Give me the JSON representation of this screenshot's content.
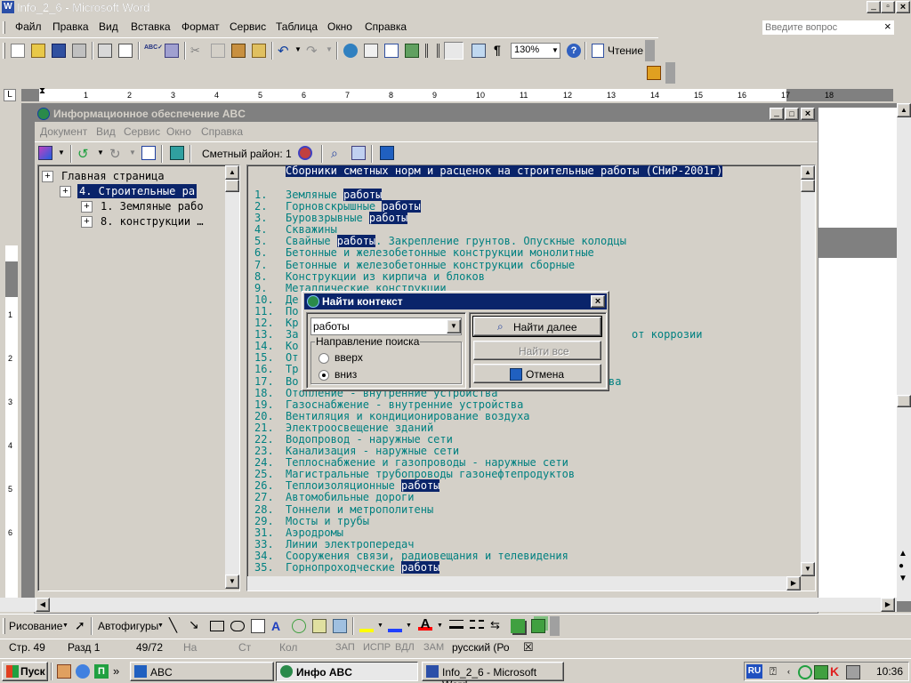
{
  "word": {
    "title": "Info_2_6 - Microsoft Word",
    "menu": [
      "Файл",
      "Правка",
      "Вид",
      "Вставка",
      "Формат",
      "Сервис",
      "Таблица",
      "Окно",
      "Справка"
    ],
    "help_placeholder": "Введите вопрос",
    "zoom": "130%",
    "reading_label": "Чтение",
    "ruler_numbers": [
      "1",
      "2",
      "3",
      "4",
      "5",
      "6",
      "7",
      "8",
      "9",
      "10",
      "11",
      "12",
      "13",
      "14",
      "15",
      "16",
      "17",
      "18"
    ],
    "vruler_numbers": [
      "1",
      "1",
      "2",
      "3",
      "4",
      "5",
      "6"
    ]
  },
  "abc": {
    "title": "Информационное обеспечение ABC",
    "menu": [
      "Документ",
      "Вид",
      "Сервис",
      "Окно",
      "Справка"
    ],
    "district_label": "Сметный район: 1",
    "tree": [
      {
        "label": "Главная страница",
        "level": 0,
        "selected": false
      },
      {
        "label": "4. Строительные ра",
        "level": 1,
        "selected": true
      },
      {
        "label": "1. Земляные рабо",
        "level": 2,
        "selected": false
      },
      {
        "label": "8. конструкции …",
        "level": 2,
        "selected": false
      }
    ],
    "doc_heading_pre": "Сборники сметных норм и расценок на строительные ",
    "doc_heading_hl": "работы",
    "doc_heading_post": " (СНиР-2001г)",
    "doc_lines": [
      {
        "num": "1.",
        "pre": "Земляные ",
        "hl": "работы",
        "post": ""
      },
      {
        "num": "2.",
        "pre": "Горновскрышные ",
        "hl": "работы",
        "post": ""
      },
      {
        "num": "3.",
        "pre": "Буровзрывные ",
        "hl": "работы",
        "post": ""
      },
      {
        "num": "4.",
        "pre": "Скважины",
        "hl": "",
        "post": ""
      },
      {
        "num": "5.",
        "pre": "Свайные ",
        "hl": "работы",
        "post": ". Закрепление грунтов. Опускные колодцы"
      },
      {
        "num": "6.",
        "pre": "Бетонные и железобетонные конструкции монолитные",
        "hl": "",
        "post": ""
      },
      {
        "num": "7.",
        "pre": "Бетонные и железобетонные конструкции сборные",
        "hl": "",
        "post": ""
      },
      {
        "num": "8.",
        "pre": "Конструкции из кирпича и блоков",
        "hl": "",
        "post": ""
      },
      {
        "num": "9.",
        "pre": "Металлические конструкции",
        "hl": "",
        "post": ""
      },
      {
        "num": "10.",
        "pre": "Де",
        "hl": "",
        "post": ""
      },
      {
        "num": "11.",
        "pre": "По",
        "hl": "",
        "post": ""
      },
      {
        "num": "12.",
        "pre": "Кр",
        "hl": "",
        "post": ""
      },
      {
        "num": "13.",
        "pre": "За",
        "hl": "",
        "post": "от коррозии"
      },
      {
        "num": "14.",
        "pre": "Ко",
        "hl": "",
        "post": ""
      },
      {
        "num": "15.",
        "pre": "От",
        "hl": "",
        "post": ""
      },
      {
        "num": "16.",
        "pre": "Тр",
        "hl": "",
        "post": ""
      },
      {
        "num": "17.",
        "pre": "Во",
        "hl": "",
        "post": "ва"
      },
      {
        "num": "18.",
        "pre": "Отопление - внутренние устройства",
        "hl": "",
        "post": ""
      },
      {
        "num": "19.",
        "pre": "Газоснабжение - внутренние устройства",
        "hl": "",
        "post": ""
      },
      {
        "num": "20.",
        "pre": "Вентиляция и кондиционирование воздуха",
        "hl": "",
        "post": ""
      },
      {
        "num": "21.",
        "pre": "Электроосвещение зданий",
        "hl": "",
        "post": ""
      },
      {
        "num": "22.",
        "pre": "Водопровод - наружные сети",
        "hl": "",
        "post": ""
      },
      {
        "num": "23.",
        "pre": "Канализация - наружные сети",
        "hl": "",
        "post": ""
      },
      {
        "num": "24.",
        "pre": "Теплоснабжение и газопроводы - наружные сети",
        "hl": "",
        "post": ""
      },
      {
        "num": "25.",
        "pre": "Магистральные трубопроводы газонефтепродуктов",
        "hl": "",
        "post": ""
      },
      {
        "num": "26.",
        "pre": "Теплоизоляционные ",
        "hl": "работы",
        "post": ""
      },
      {
        "num": "27.",
        "pre": "Автомобильные дороги",
        "hl": "",
        "post": ""
      },
      {
        "num": "28.",
        "pre": "Тоннели и метрополитены",
        "hl": "",
        "post": ""
      },
      {
        "num": "29.",
        "pre": "Мосты и трубы",
        "hl": "",
        "post": ""
      },
      {
        "num": "31.",
        "pre": "Аэродромы",
        "hl": "",
        "post": ""
      },
      {
        "num": "33.",
        "pre": "Линии электропередач",
        "hl": "",
        "post": ""
      },
      {
        "num": "34.",
        "pre": "Сооружения связи, радиовещания и телевидения",
        "hl": "",
        "post": ""
      },
      {
        "num": "35.",
        "pre": "Горнопроходческие ",
        "hl": "работы",
        "post": ""
      }
    ]
  },
  "dialog": {
    "title": "Найти контекст",
    "search_value": "работы",
    "direction_label": "Направление поиска",
    "option_up": "вверх",
    "option_down": "вниз",
    "selected_option": "вниз",
    "find_next": "Найти далее",
    "find_all": "Найти все",
    "cancel": "Отмена"
  },
  "drawing": {
    "draw_label": "Рисование",
    "autoshapes_label": "Автофигуры"
  },
  "status": {
    "page": "Стр. 49",
    "section": "Разд 1",
    "pages": "49/72",
    "at": "На",
    "line": "Ст",
    "col": "Кол",
    "rec": "ЗАП",
    "trk": "ИСПР",
    "ext": "ВДЛ",
    "ovr": "ЗАМ",
    "lang": "русский (Ро"
  },
  "taskbar": {
    "start": "Пуск",
    "tasks": [
      "ABC",
      "Инфо ABC",
      "Info_2_6 - Microsoft Word"
    ],
    "lang": "RU",
    "clock": "10:36"
  },
  "colors": {
    "title_active": "#0a246a",
    "title_inactive": "#808080",
    "doc_text": "#008080",
    "highlight": "#0a246a"
  }
}
